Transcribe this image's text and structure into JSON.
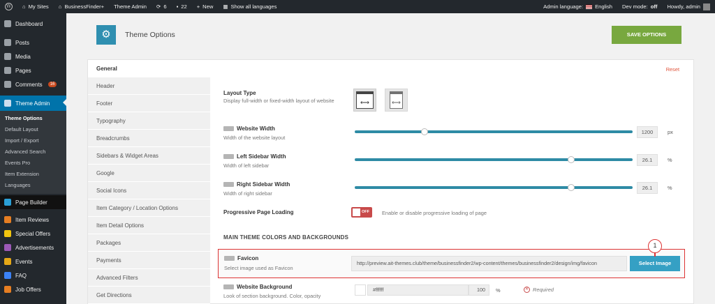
{
  "adminbar": {
    "my_sites": "My Sites",
    "site_name": "BusinessFinder+",
    "theme_admin": "Theme Admin",
    "updates_count": "6",
    "comments_count": "22",
    "new_label": "New",
    "show_languages": "Show all languages",
    "admin_language_label": "Admin language:",
    "admin_language_value": "English",
    "dev_mode_label": "Dev mode:",
    "dev_mode_value": "off",
    "howdy": "Howdy, admin"
  },
  "sidebar": {
    "items": [
      {
        "label": "Dashboard"
      },
      {
        "label": "Posts"
      },
      {
        "label": "Media"
      },
      {
        "label": "Pages"
      },
      {
        "label": "Comments",
        "badge": "16"
      },
      {
        "label": "Theme Admin"
      }
    ],
    "submenu": [
      "Theme Options",
      "Default Layout",
      "Import / Export",
      "Advanced Search",
      "Events Pro",
      "Item Extension",
      "Languages"
    ],
    "bottom_items": [
      {
        "label": "Page Builder"
      },
      {
        "label": "Item Reviews"
      },
      {
        "label": "Special Offers"
      },
      {
        "label": "Advertisements"
      },
      {
        "label": "Events"
      },
      {
        "label": "FAQ"
      },
      {
        "label": "Job Offers"
      }
    ]
  },
  "header": {
    "title": "Theme Options",
    "save_label": "SAVE OPTIONS"
  },
  "tabs": [
    "General",
    "Header",
    "Footer",
    "Typography",
    "Breadcrumbs",
    "Sidebars & Widget Areas",
    "Google",
    "Social Icons",
    "Item Category / Location Options",
    "Item Detail Options",
    "Packages",
    "Payments",
    "Advanced Filters",
    "Get Directions"
  ],
  "reset_label": "Reset",
  "options": {
    "layout_type": {
      "label": "Layout Type",
      "desc": "Display full-width or fixed-width layout of website"
    },
    "website_width": {
      "label": "Website Width",
      "desc": "Width of the website layout",
      "value": "1200",
      "unit": "px",
      "fraction": 0.25
    },
    "left_sidebar": {
      "label": "Left Sidebar Width",
      "desc": "Width of left sidebar",
      "value": "26.1",
      "unit": "%",
      "fraction": 0.78
    },
    "right_sidebar": {
      "label": "Right Sidebar Width",
      "desc": "Width of right sidebar",
      "value": "26.1",
      "unit": "%",
      "fraction": 0.78
    },
    "progressive": {
      "label": "Progressive Page Loading",
      "toggle": "OFF",
      "desc": "Enable or disable progressive loading of page"
    },
    "section_title": "MAIN THEME COLORS AND BACKGROUNDS",
    "favicon": {
      "label": "Favicon",
      "desc": "Select image used as Favicon",
      "url": "http://preview.ait-themes.club/theme/businessfinder2/wp-content/themes/businessfinder2/design/img/favicon",
      "button": "Select Image"
    },
    "website_bg": {
      "label": "Website Background",
      "desc": "Look of section background. Color, opacity",
      "hex": "#ffffff",
      "opacity": "100",
      "pct": "%",
      "required": "Required"
    }
  },
  "callout_number": "1",
  "colors": {
    "accent": "#2e8ba5",
    "save": "#78a83f",
    "admin_active": "#0073aa",
    "danger": "#c84a4a"
  }
}
